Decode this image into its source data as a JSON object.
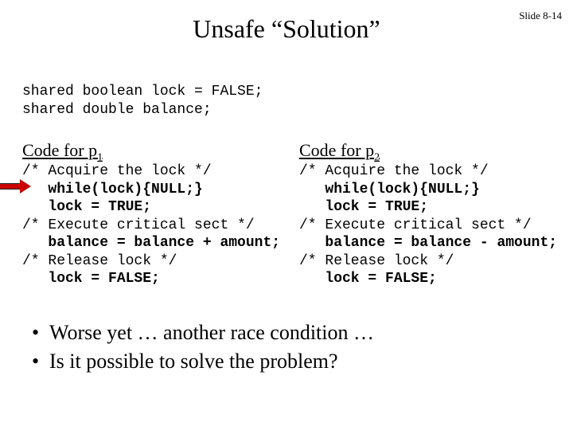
{
  "slide_number": "Slide 8-14",
  "title": "Unsafe “Solution”",
  "shared_decl": "shared boolean lock = FALSE;\nshared double balance;",
  "col1": {
    "heading_prefix": "Code for p",
    "heading_sub": "1",
    "l1": "/* Acquire the lock */",
    "l2": "   while(lock){NULL;}",
    "l3": "   lock = TRUE;",
    "l4": "/* Execute critical sect */",
    "l5": "   balance = balance + amount;",
    "l6": "/* Release lock */",
    "l7": "   lock = FALSE;"
  },
  "col2": {
    "heading_prefix": "Code for p",
    "heading_sub": "2",
    "l1": "/* Acquire the lock */",
    "l2": "   while(lock){NULL;}",
    "l3": "   lock = TRUE;",
    "l4": "/* Execute critical sect */",
    "l5": "   balance = balance - amount;",
    "l6": "/* Release lock */",
    "l7": "   lock = FALSE;"
  },
  "bullets": {
    "b1": "Worse yet … another race condition …",
    "b2": "Is it possible to solve the problem?"
  }
}
